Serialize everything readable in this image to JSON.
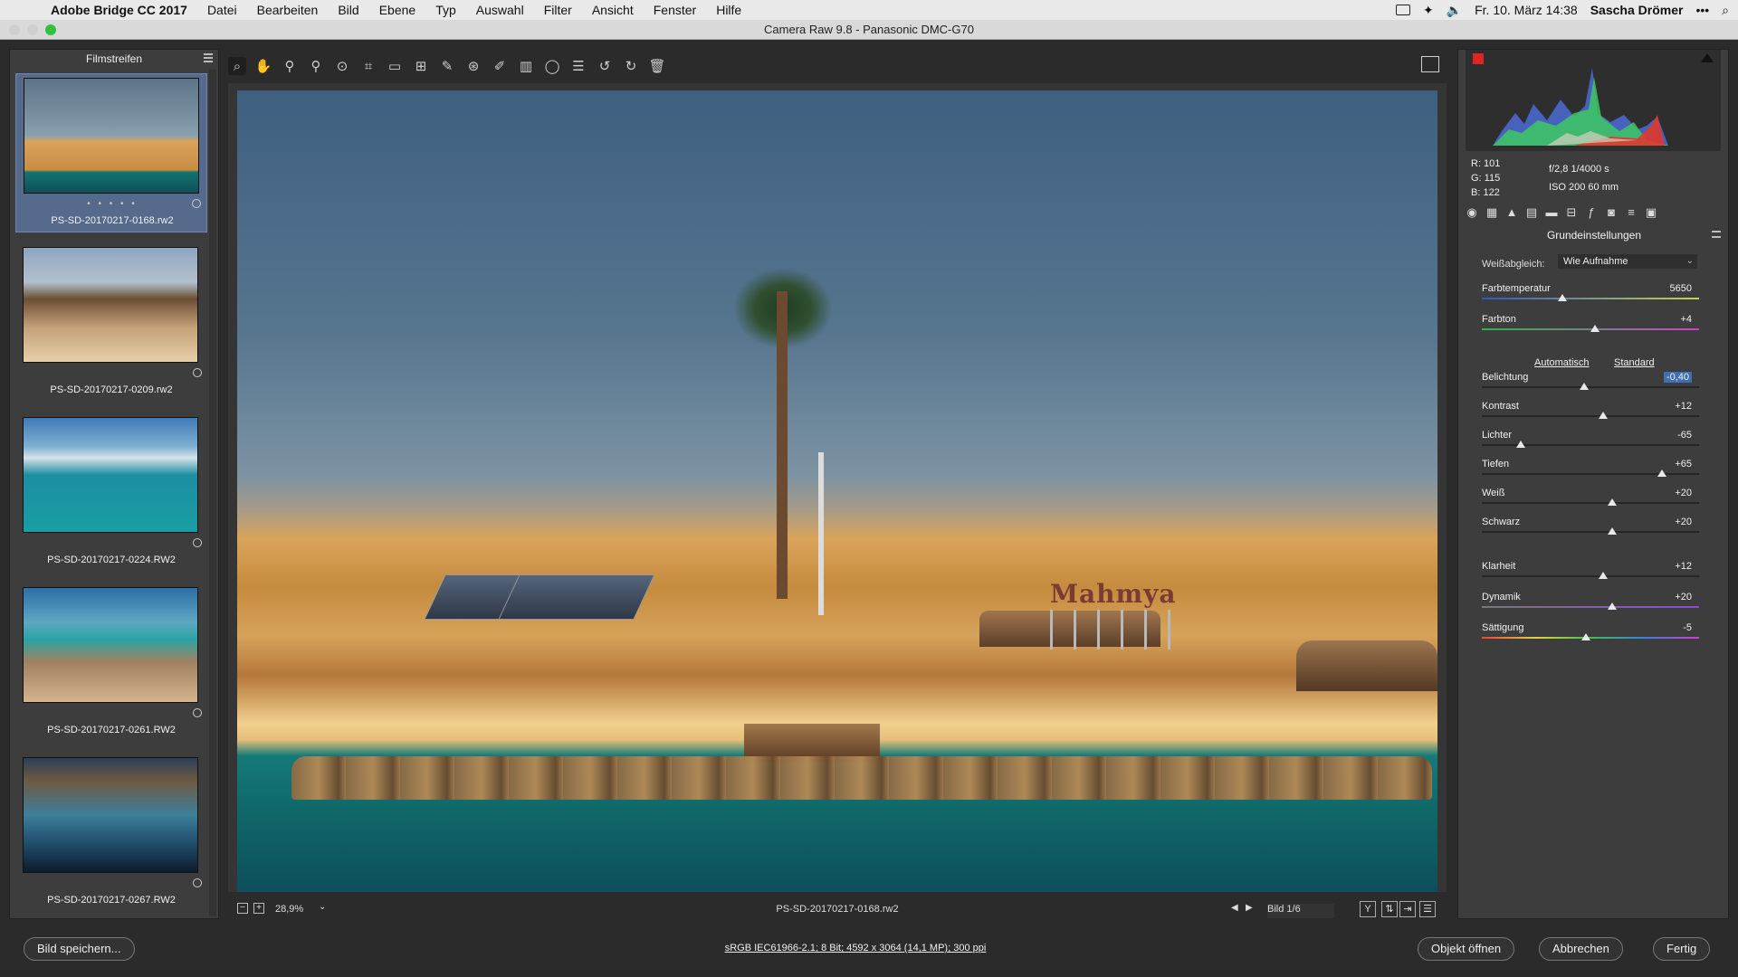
{
  "menubar": {
    "app_name": "Adobe Bridge CC 2017",
    "items": [
      "Datei",
      "Bearbeiten",
      "Bild",
      "Ebene",
      "Typ",
      "Auswahl",
      "Filter",
      "Ansicht",
      "Fenster",
      "Hilfe"
    ],
    "clock": "Fr. 10. März  14:38",
    "user": "Sascha Drömer",
    "more": "•••"
  },
  "window": {
    "title": "Camera Raw 9.8 - Panasonic DMC-G70"
  },
  "filmstrip": {
    "title": "Filmstreifen",
    "items": [
      {
        "name": "PS-SD-20170217-0168.rw2",
        "selected": true,
        "rating": "• • • • •"
      },
      {
        "name": "PS-SD-20170217-0209.rw2",
        "selected": false
      },
      {
        "name": "PS-SD-20170217-0224.RW2",
        "selected": false
      },
      {
        "name": "PS-SD-20170217-0261.RW2",
        "selected": false
      },
      {
        "name": "PS-SD-20170217-0267.RW2",
        "selected": false
      }
    ]
  },
  "toolbar": {
    "tools": [
      "zoom-tool",
      "hand-tool",
      "white-balance-tool",
      "color-sampler-tool",
      "targeted-adjustment-tool",
      "crop-tool",
      "straighten-tool",
      "transform-tool",
      "spot-removal-tool",
      "red-eye-tool",
      "adjustment-brush",
      "graduated-filter",
      "radial-filter",
      "presets-list",
      "rotate-left",
      "rotate-right",
      "delete"
    ],
    "tool_glyphs": [
      "⌕",
      "✋",
      "⚲",
      "⚲",
      "⊙",
      "⌗",
      "▭",
      "⊞",
      "✎",
      "⊛",
      "✐",
      "▥",
      "◯",
      "☰",
      "↺",
      "↻",
      "🗑"
    ]
  },
  "preview": {
    "sign_text": "Mahmya",
    "zoom": "28,9%",
    "file_name": "PS-SD-20170217-0168.rw2",
    "image_counter": "Bild 1/6"
  },
  "readout": {
    "r": "R:   101",
    "g": "G:   115",
    "b": "B:   122",
    "aperture_shutter": "f/2,8    1/4000 s",
    "iso_focal": "ISO 200    60 mm"
  },
  "panel": {
    "title": "Grundeinstellungen",
    "white_balance_label": "Weißabgleich:",
    "white_balance_value": "Wie Aufnahme",
    "auto_link": "Automatisch",
    "default_link": "Standard",
    "sliders": [
      {
        "label": "Farbtemperatur",
        "value": "5650",
        "position": 0.37
      },
      {
        "label": "Farbton",
        "value": "+4",
        "position": 0.52
      },
      {
        "label": "Belichtung",
        "value": "-0,40",
        "position": 0.47,
        "highlighted": true
      },
      {
        "label": "Kontrast",
        "value": "+12",
        "position": 0.56
      },
      {
        "label": "Lichter",
        "value": "-65",
        "position": 0.18
      },
      {
        "label": "Tiefen",
        "value": "+65",
        "position": 0.83
      },
      {
        "label": "Weiß",
        "value": "+20",
        "position": 0.6
      },
      {
        "label": "Schwarz",
        "value": "+20",
        "position": 0.6
      },
      {
        "label": "Klarheit",
        "value": "+12",
        "position": 0.56
      },
      {
        "label": "Dynamik",
        "value": "+20",
        "position": 0.6
      },
      {
        "label": "Sättigung",
        "value": "-5",
        "position": 0.48
      }
    ]
  },
  "bottom": {
    "save_button": "Bild speichern...",
    "info": "sRGB IEC61966-2.1; 8 Bit; 4592 x 3064 (14,1 MP); 300 ppi",
    "open_button": "Objekt öffnen",
    "cancel_button": "Abbrechen",
    "done_button": "Fertig"
  }
}
